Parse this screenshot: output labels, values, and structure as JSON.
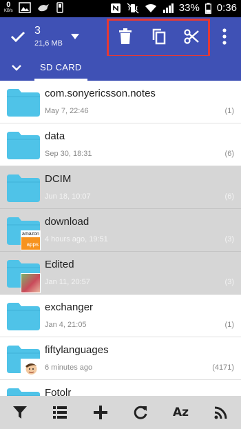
{
  "status_bar": {
    "data_rate": "0",
    "data_unit": "KB/s",
    "battery_percent": "33%",
    "time": "0:36"
  },
  "toolbar": {
    "selected_count": "3",
    "selected_size": "21,6 MB",
    "actions": [
      "delete-icon",
      "copy-icon",
      "cut-icon",
      "more-vertical-icon"
    ],
    "accent_color": "#3f51b5",
    "highlight_color": "#e53935"
  },
  "tabs": {
    "current": "SD CARD"
  },
  "files": [
    {
      "name": "com.sonyericsson.notes",
      "date": "May 7, 22:46",
      "count": "(1)",
      "selected": false
    },
    {
      "name": "data",
      "date": "Sep 30, 18:31",
      "count": "(6)",
      "selected": false
    },
    {
      "name": "DCIM",
      "date": "Jun 18, 10:07",
      "count": "(6)",
      "selected": true
    },
    {
      "name": "download",
      "date": "4 hours ago, 19:51",
      "count": "(3)",
      "selected": true,
      "thumb": "amazon-apps-thumbnail",
      "thumb_text_top": "amazon",
      "thumb_text_bottom": "apps"
    },
    {
      "name": "Edited",
      "date": "Jan 11, 20:57",
      "count": "(3)",
      "selected": true,
      "thumb": "photo-thumbnail"
    },
    {
      "name": "exchanger",
      "date": "Jan 4, 21:05",
      "count": "(1)",
      "selected": false
    },
    {
      "name": "fiftylanguages",
      "date": "6 minutes ago",
      "count": "(4171)",
      "selected": false,
      "thumb": "avatar-thumbnail"
    },
    {
      "name": "Fotolr",
      "date": "",
      "count": "",
      "selected": false
    }
  ],
  "bottom_bar": {
    "buttons": [
      "filter-icon",
      "list-view-icon",
      "add-icon",
      "refresh-icon",
      "sort-az-icon",
      "signal-icon"
    ],
    "sort_label": "Az"
  },
  "folder_color": "#4fc3e8"
}
